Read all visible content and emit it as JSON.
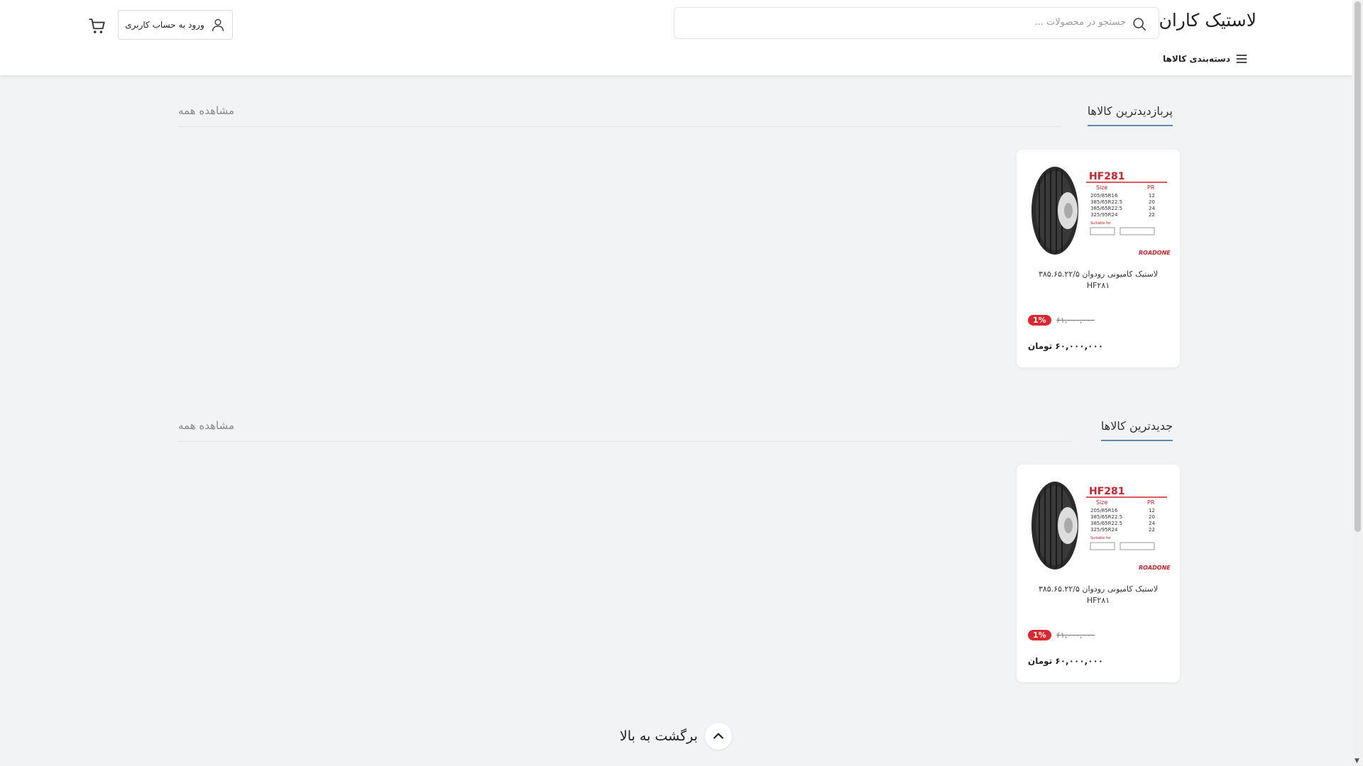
{
  "header": {
    "logo": "لاستیک کاران",
    "search_placeholder": "جستجو در محصولات ...",
    "categories_label": "دسته‌بندی کالاها",
    "login_label": "ورود به حساب کاربری"
  },
  "sections": [
    {
      "title": "پربازدیدترین کالاها",
      "see_all": "مشاهده همه",
      "product": {
        "name": "لاستیک کامیونی رودوان ۳۸۵.۶۵.۲۲/۵ HF۲۸۱",
        "image_text": "HF281",
        "brand": "ROADONE",
        "discount": "1%",
        "old_price": "۶۱,۰۰۰,۰۰۰",
        "price": "۶۰,۰۰۰,۰۰۰ تومان"
      }
    },
    {
      "title": "جدیدترین کالاها",
      "see_all": "مشاهده همه",
      "product": {
        "name": "لاستیک کامیونی رودوان ۳۸۵.۶۵.۲۲/۵ HF۲۸۱",
        "image_text": "HF281",
        "brand": "ROADONE",
        "discount": "1%",
        "old_price": "۶۱,۰۰۰,۰۰۰",
        "price": "۶۰,۰۰۰,۰۰۰ تومان"
      }
    }
  ],
  "spec_table": {
    "headers": [
      "Size",
      "PR"
    ],
    "rows": [
      [
        "205/85R16",
        "12"
      ],
      [
        "385/65R22.5",
        "20"
      ],
      [
        "385/65R22.5",
        "24"
      ],
      [
        "325/95R24",
        "22"
      ]
    ],
    "suitable": "Suitable for"
  },
  "back_to_top": "برگشت به بالا"
}
